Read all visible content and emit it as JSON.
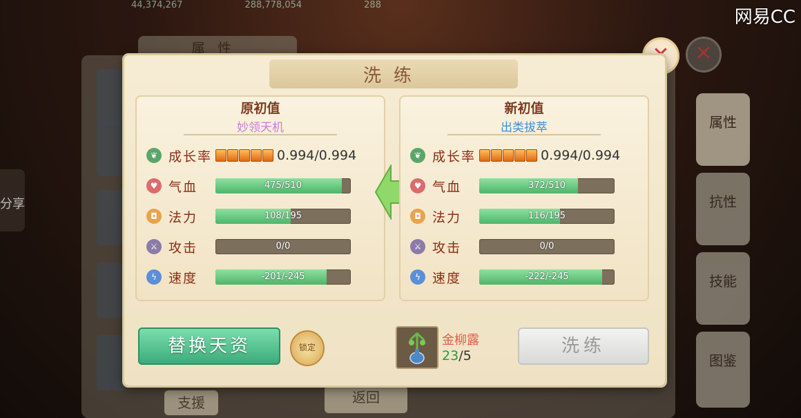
{
  "watermark": "网易CC",
  "background": {
    "top_values": [
      "44,374,267",
      "288,778,054",
      "288"
    ],
    "attr_tab_label": "属性",
    "side_tabs": [
      "属性",
      "抗性",
      "技能",
      "图鉴"
    ],
    "share_label": "分享",
    "support_label": "支援",
    "back_label": "返回"
  },
  "dialog": {
    "title": "洗练",
    "left": {
      "title": "原初值",
      "subtitle": "妙领天机",
      "growth_label": "成长率",
      "growth_value": "0.994/0.994",
      "growth_pips": 5,
      "stats": [
        {
          "label": "气血",
          "text": "475/510",
          "fill": 0.9314,
          "icon": "heart-icon"
        },
        {
          "label": "法力",
          "text": "108/195",
          "fill": 0.5538,
          "icon": "mana-icon"
        },
        {
          "label": "攻击",
          "text": "0/0",
          "fill": 0,
          "icon": "sword-icon"
        },
        {
          "label": "速度",
          "text": "-201/-245",
          "fill": 0.8204,
          "icon": "speed-icon"
        }
      ]
    },
    "right": {
      "title": "新初值",
      "subtitle": "出类拔萃",
      "growth_label": "成长率",
      "growth_value": "0.994/0.994",
      "growth_pips": 5,
      "stats": [
        {
          "label": "气血",
          "text": "372/510",
          "fill": 0.7294,
          "icon": "heart-icon"
        },
        {
          "label": "法力",
          "text": "116/195",
          "fill": 0.5949,
          "icon": "mana-icon"
        },
        {
          "label": "攻击",
          "text": "0/0",
          "fill": 0,
          "icon": "sword-icon"
        },
        {
          "label": "速度",
          "text": "-222/-245",
          "fill": 0.9061,
          "icon": "speed-icon"
        }
      ]
    },
    "replace_button": "替换天资",
    "lock_label": "锁定",
    "item_name": "金柳露",
    "item_have": "23",
    "item_need": "/5",
    "wash_button": "洗练",
    "colors": {
      "accent_green": "#4cb66a",
      "title_brown": "#8a5a3a",
      "stat_red": "#8b2b14"
    }
  }
}
